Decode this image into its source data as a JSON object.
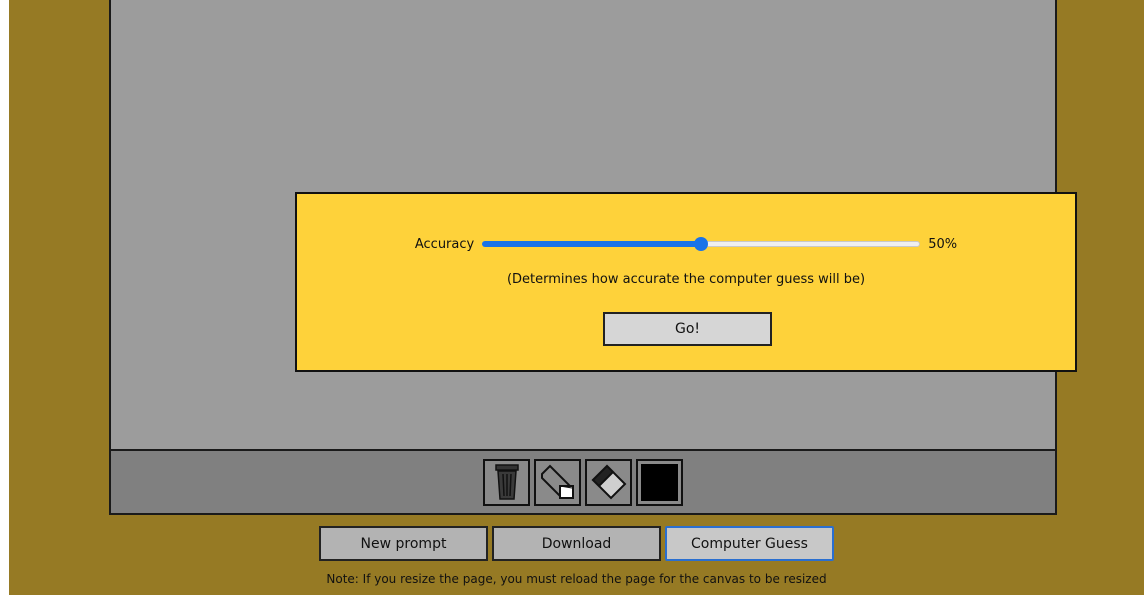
{
  "accuracy": {
    "label": "Accuracy",
    "value_percent": 50,
    "value_text": "50%",
    "fill_color": "#1a73e8"
  },
  "hint": "(Determines how accurate the computer guess will be)",
  "go_label": "Go!",
  "tools": [
    {
      "name": "trash-icon"
    },
    {
      "name": "eraser-outline-icon"
    },
    {
      "name": "pen-icon"
    },
    {
      "name": "color-swatch",
      "color": "#000000"
    }
  ],
  "buttons": {
    "new_prompt": "New prompt",
    "download": "Download",
    "computer_guess": "Computer Guess"
  },
  "note": "Note: If you resize the page, you must reload the page for the canvas to be resized",
  "colors": {
    "background": "#967a24",
    "canvas": "#9c9c9c",
    "toolbar": "#808080",
    "modal": "#fed23a"
  }
}
